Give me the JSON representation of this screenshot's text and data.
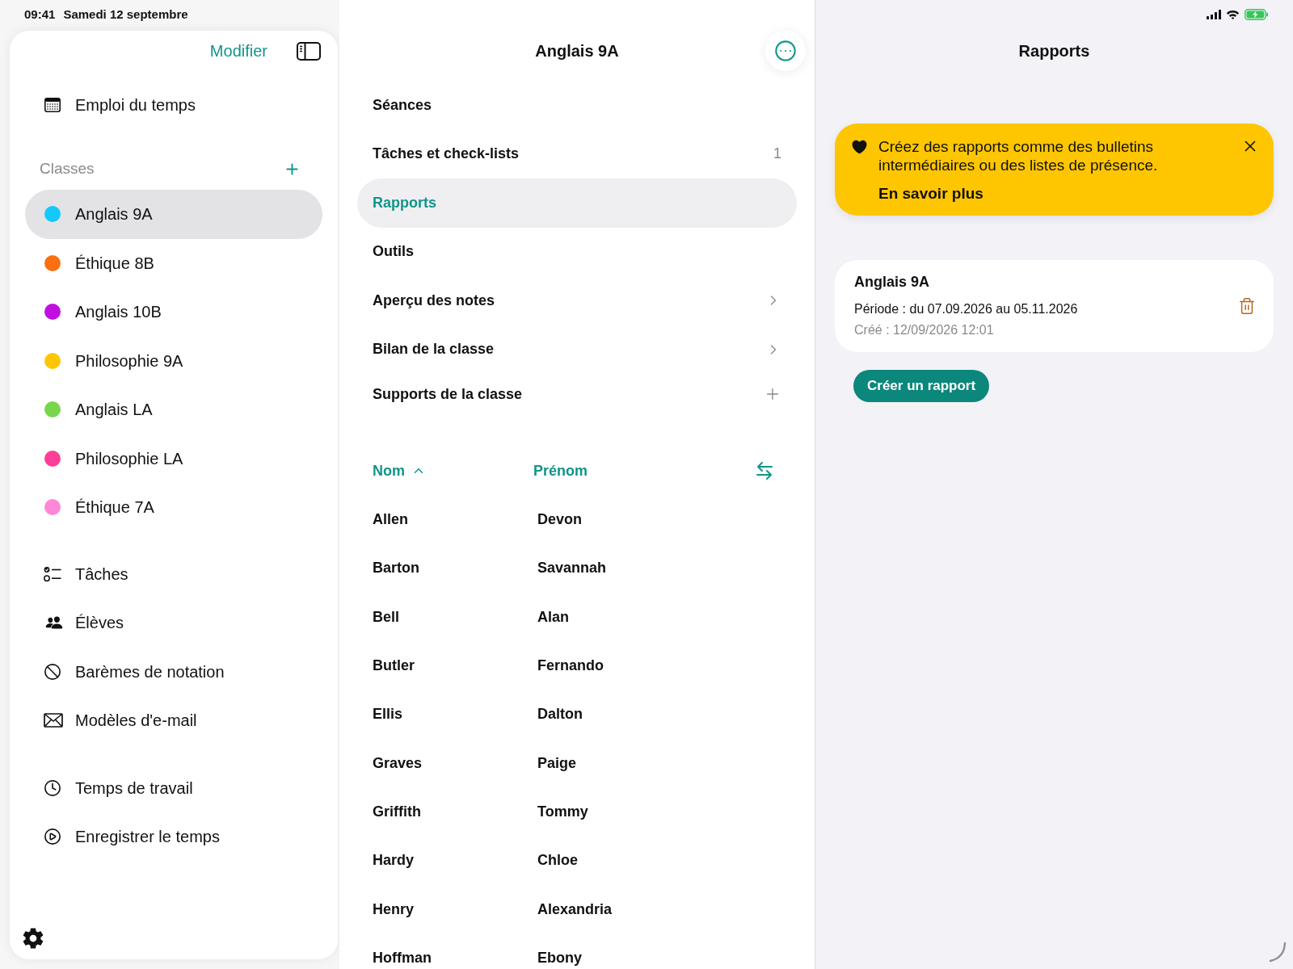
{
  "status_bar": {
    "time": "09:41",
    "date": "Samedi 12 septembre"
  },
  "sidebar": {
    "edit_button": "Modifier",
    "schedule_item": "Emploi du temps",
    "classes_title": "Classes",
    "classes": [
      {
        "name": "Anglais 9A",
        "color": "#14c8fa",
        "selected": true
      },
      {
        "name": "Éthique 8B",
        "color": "#fb6f10",
        "selected": false
      },
      {
        "name": "Anglais 10B",
        "color": "#c00fe0",
        "selected": false
      },
      {
        "name": "Philosophie 9A",
        "color": "#fec600",
        "selected": false
      },
      {
        "name": "Anglais LA",
        "color": "#78d64b",
        "selected": false
      },
      {
        "name": "Philosophie LA",
        "color": "#fd3f98",
        "selected": false
      },
      {
        "name": "Éthique 7A",
        "color": "#fe87d8",
        "selected": false
      }
    ],
    "tools": [
      "Tâches",
      "Élèves",
      "Barèmes de notation",
      "Modèles d'e-mail"
    ],
    "time_tracking": [
      "Temps de travail",
      "Enregistrer le temps"
    ]
  },
  "class_panel": {
    "title": "Anglais 9A",
    "menu": [
      {
        "label": "Séances",
        "kind": "plain",
        "selected": false
      },
      {
        "label": "Tâches et check-lists",
        "kind": "count",
        "count": "1",
        "selected": false
      },
      {
        "label": "Rapports",
        "kind": "plain",
        "selected": true
      },
      {
        "label": "Outils",
        "kind": "plain",
        "selected": false
      },
      {
        "label": "Aperçu des notes",
        "kind": "link",
        "selected": false
      },
      {
        "label": "Bilan de la classe",
        "kind": "link",
        "selected": false
      },
      {
        "label": "Supports de la classe",
        "kind": "add",
        "selected": false
      }
    ],
    "students": {
      "columns": [
        {
          "label": "Nom",
          "sorted": true
        },
        {
          "label": "Prénom",
          "sorted": false
        }
      ],
      "rows": [
        [
          "Allen",
          "Devon"
        ],
        [
          "Barton",
          "Savannah"
        ],
        [
          "Bell",
          "Alan"
        ],
        [
          "Butler",
          "Fernando"
        ],
        [
          "Ellis",
          "Dalton"
        ],
        [
          "Graves",
          "Paige"
        ],
        [
          "Griffith",
          "Tommy"
        ],
        [
          "Hardy",
          "Chloe"
        ],
        [
          "Henry",
          "Alexandria"
        ],
        [
          "Hoffman",
          "Ebony"
        ]
      ]
    }
  },
  "reports_panel": {
    "title": "Rapports",
    "banner": {
      "message": "Créez des rapports comme des bulletins intermédiaires ou des listes de présence.",
      "link": "En savoir plus"
    },
    "reports": [
      {
        "title": "Anglais 9A",
        "period": "Période : du 07.09.2026 au 05.11.2026",
        "created": "Créé : 12/09/2026 12:01"
      }
    ],
    "create_button": "Créer un rapport"
  }
}
